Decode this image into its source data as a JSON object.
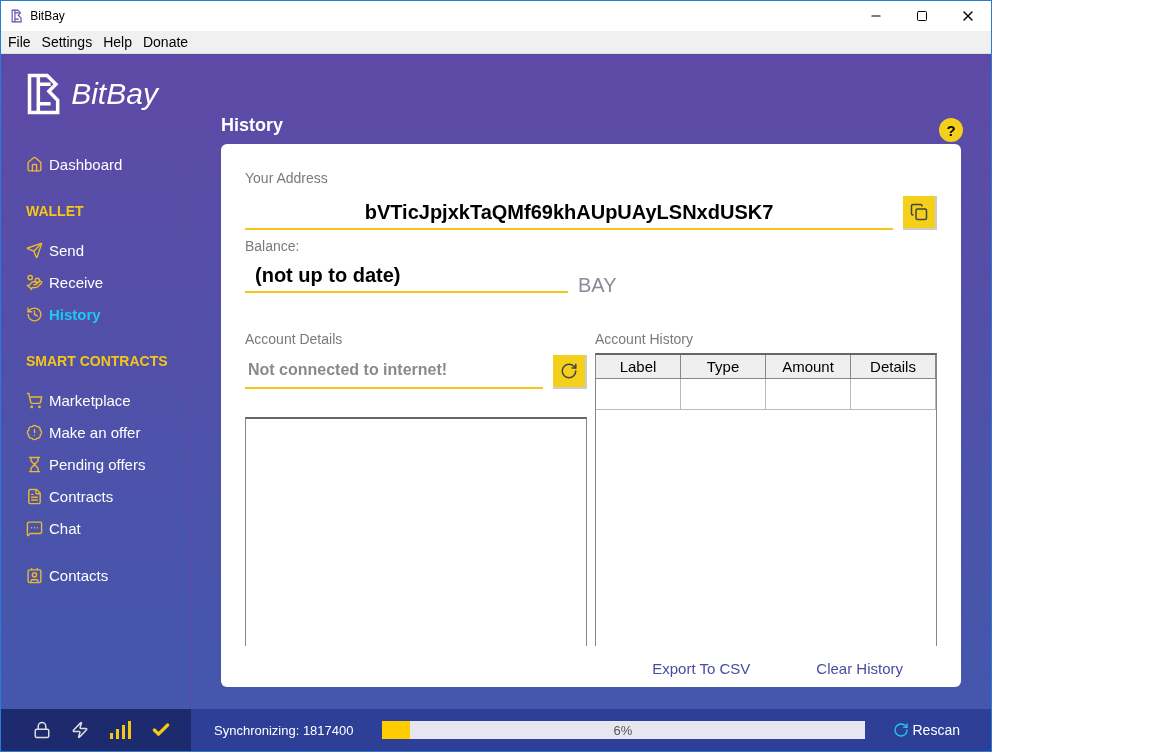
{
  "window": {
    "title": "BitBay"
  },
  "menu": [
    "File",
    "Settings",
    "Help",
    "Donate"
  ],
  "sidebar": {
    "logo": "BitBay",
    "sections": [
      {
        "items": [
          {
            "label": "Dashboard",
            "selected": false
          }
        ]
      },
      {
        "heading": "WALLET",
        "items": [
          {
            "label": "Send",
            "selected": false
          },
          {
            "label": "Receive",
            "selected": false
          },
          {
            "label": "History",
            "selected": true
          }
        ]
      },
      {
        "heading": "SMART CONTRACTS",
        "items": [
          {
            "label": "Marketplace",
            "selected": false
          },
          {
            "label": "Make an offer",
            "selected": false
          },
          {
            "label": "Pending offers",
            "selected": false
          },
          {
            "label": "Contracts",
            "selected": false
          },
          {
            "label": "Chat",
            "selected": false
          }
        ]
      },
      {
        "items": [
          {
            "label": "Contacts",
            "selected": false
          }
        ]
      }
    ]
  },
  "page": {
    "title": "History",
    "help": "?"
  },
  "address": {
    "label": "Your Address",
    "value": "bVTicJpjxkTaQMf69khAUpUAyLSNxdUSK7"
  },
  "balance": {
    "label": "Balance:",
    "value": "(not up to date)",
    "unit": "BAY"
  },
  "account_details": {
    "label": "Account Details",
    "status": "Not connected to internet!"
  },
  "account_history": {
    "label": "Account History",
    "columns": [
      "Label",
      "Type",
      "Amount",
      "Details"
    ]
  },
  "actions": [
    "Export To CSV",
    "Clear History"
  ],
  "status_bar": {
    "sync_label": "Synchronizing: 1817400",
    "progress": {
      "level": 0.06,
      "reading": "6%"
    },
    "rescan": "Rescan"
  }
}
